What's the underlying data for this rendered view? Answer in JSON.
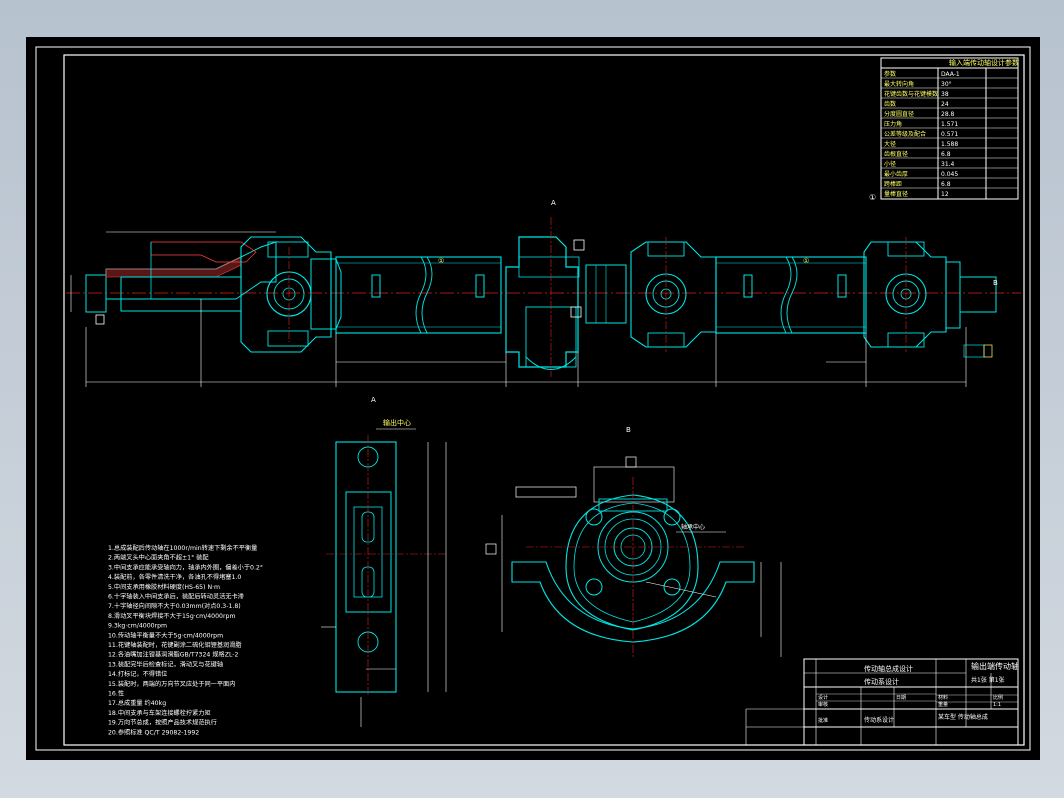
{
  "colors": {
    "background": "#000000",
    "border": "#ffffff",
    "geometry": "#00e5e5",
    "centerline": "#e02020",
    "dimension": "#ffffff",
    "annotation": "#ffff66",
    "hatch": "#ff4040"
  },
  "spec_table": {
    "title": "输入端传动轴设计参数",
    "rows": [
      {
        "label": "参数",
        "value": "DAA-1"
      },
      {
        "label": "最大转向角",
        "value": "30°"
      },
      {
        "label": "花键齿数与花键模数",
        "value": "38"
      },
      {
        "label": "齿数",
        "value": "24"
      },
      {
        "label": "分度圆直径",
        "value": "28.8"
      },
      {
        "label": "压力角",
        "value": "1.571"
      },
      {
        "label": "公差等级及配合",
        "value": "0.571"
      },
      {
        "label": "大径",
        "value": "1.588"
      },
      {
        "label": "齿根直径",
        "value": "6.8"
      },
      {
        "label": "小径",
        "value": "31.4"
      },
      {
        "label": "最小齿厚",
        "value": "0.045"
      },
      {
        "label": "跨棒距",
        "value": "6.8"
      },
      {
        "label": "量棒直径",
        "value": "12"
      }
    ]
  },
  "section_labels": {
    "view_a": "A",
    "view_b": "B",
    "center_marker": "输出中心",
    "flange_label": "轴承中心",
    "note_mark": "①"
  },
  "technical_notes": [
    "1.总成装配后传动轴在1000r/min转速下剩余不平衡量",
    "2.两端叉头中心面夹角不超±1° 装配",
    "3.中间支承应能承受轴向力，轴承内外圈，偏差小于0.2°",
    "4.装配前，各零件清洗干净，各油孔不得堵塞1.0",
    "5.中间支承用橡胶材料硬度(HS-65) N·m",
    "6.十字轴装入中间支承后，装配后转动灵活无卡滞",
    "7.十字轴径向间隙不大于0.03mm(对点0.3-1.8)",
    "8.滑动叉平衡块焊接不大于15g·cm/4000rpm",
    "9.3kg·cm/4000rpm",
    "10.传动轴平衡量不大于5g·cm/4000rpm",
    "11.花键轴装配时，花键副涂二硫化钼锂基润滑脂",
    "12.各油嘴加注锂基润滑脂GB/T7324 规格ZL-2",
    "13.装配完毕后检查标记，滑动叉与花键轴",
    "14.打标记，不得错位",
    "15.装配时，两端的万向节叉应处于同一平面内",
    "16.性",
    "17.总成重量 约40kg",
    "18.中间支承与车架连接螺栓拧紧力矩",
    "19.万向节总成，按照产品技术规范执行",
    "20.参照标准 QC/T 29082-1992"
  ],
  "title_block": {
    "project": "传动轴总成设计",
    "drawing_title": "某车型 传动轴总成",
    "drawing_no": "输出端传动轴",
    "company": "传动系设计",
    "scale_label": "比例",
    "scale": "1:1",
    "sheet": "共1张 第1张",
    "designer": "设计",
    "checker": "审核",
    "approver": "批准",
    "date": "日期",
    "material": "材料",
    "weight": "重量"
  }
}
